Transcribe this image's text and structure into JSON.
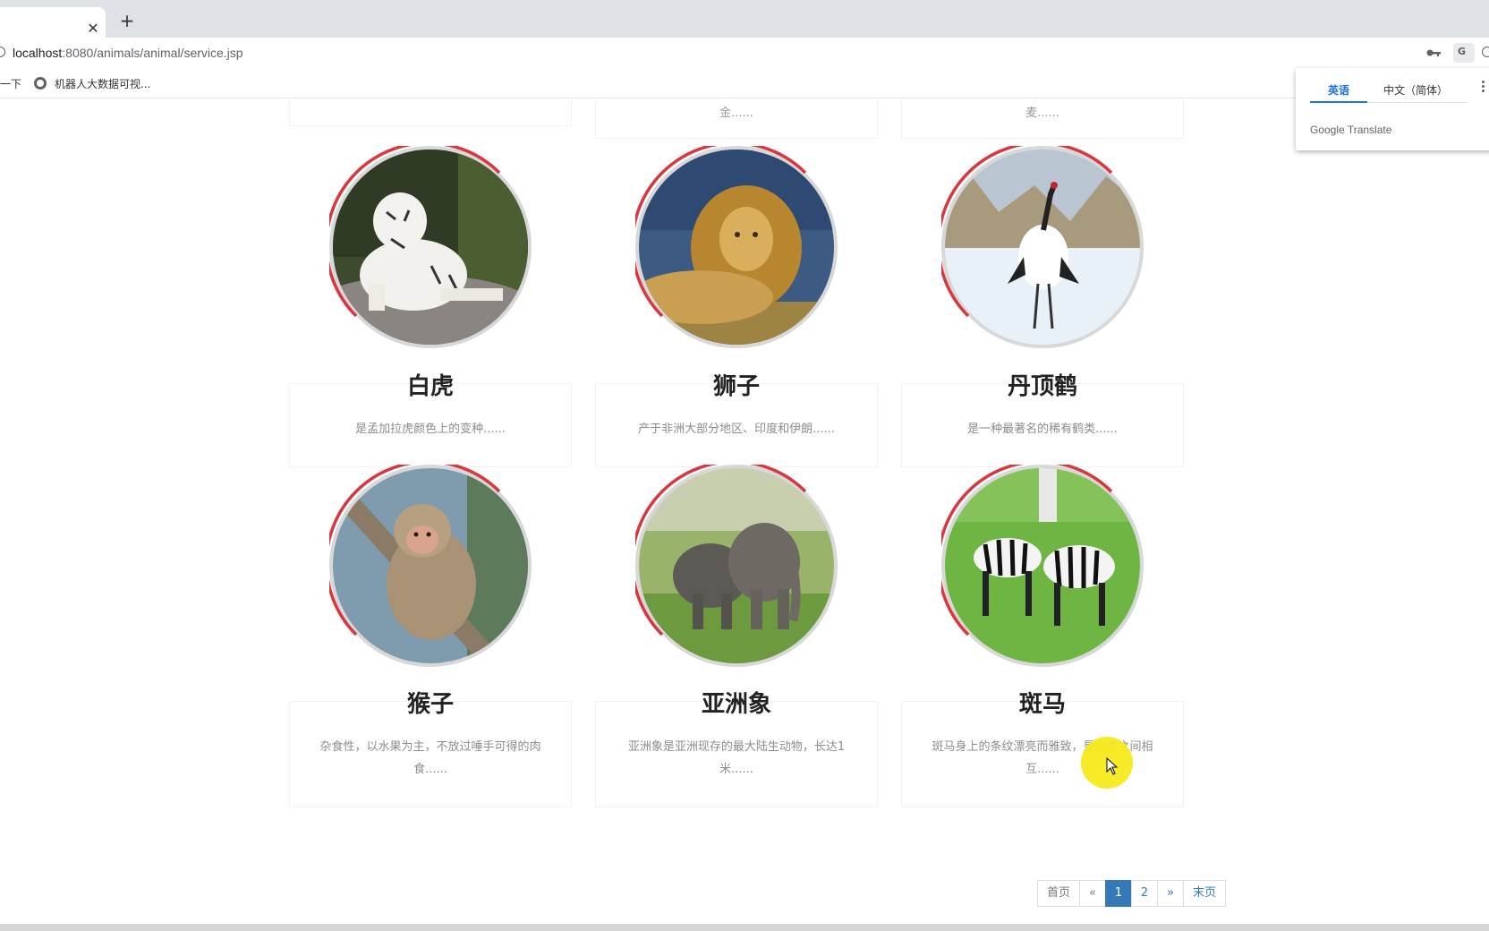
{
  "browser": {
    "url_host": "localhost",
    "url_rest": ":8080/animals/animal/service.jsp",
    "bookmarks": [
      "一下",
      "机器人大数据可视..."
    ]
  },
  "translate_popup": {
    "tab_english": "英语",
    "tab_chinese": "中文（简体）",
    "brand": "Google Translate"
  },
  "top_snippets": [
    "金......",
    "麦......"
  ],
  "animals": [
    {
      "name": "白虎",
      "desc": "是孟加拉虎颜色上的变种......",
      "icon": "white-tiger-photo"
    },
    {
      "name": "狮子",
      "desc": "产于非洲大部分地区、印度和伊朗......",
      "icon": "lion-photo"
    },
    {
      "name": "丹顶鹤",
      "desc": "是一种最著名的稀有鹤类......",
      "icon": "red-crowned-crane-photo"
    },
    {
      "name": "猴子",
      "desc": "杂食性，以水果为主，不放过唾手可得的肉食......",
      "icon": "monkey-photo"
    },
    {
      "name": "亚洲象",
      "desc": "亚洲象是亚洲现存的最大陆生动物，长达1米......",
      "icon": "asian-elephant-photo"
    },
    {
      "name": "斑马",
      "desc": "斑马身上的条纹漂亮而雅致，是同类之间相互......",
      "icon": "zebra-photo"
    }
  ],
  "pagination": {
    "first": "首页",
    "prev": "«",
    "pages": [
      "1",
      "2"
    ],
    "next": "»",
    "last": "末页",
    "current": "1"
  },
  "colors": {
    "accent_ring": "#d9363e",
    "pagination_active": "#337ab7"
  }
}
